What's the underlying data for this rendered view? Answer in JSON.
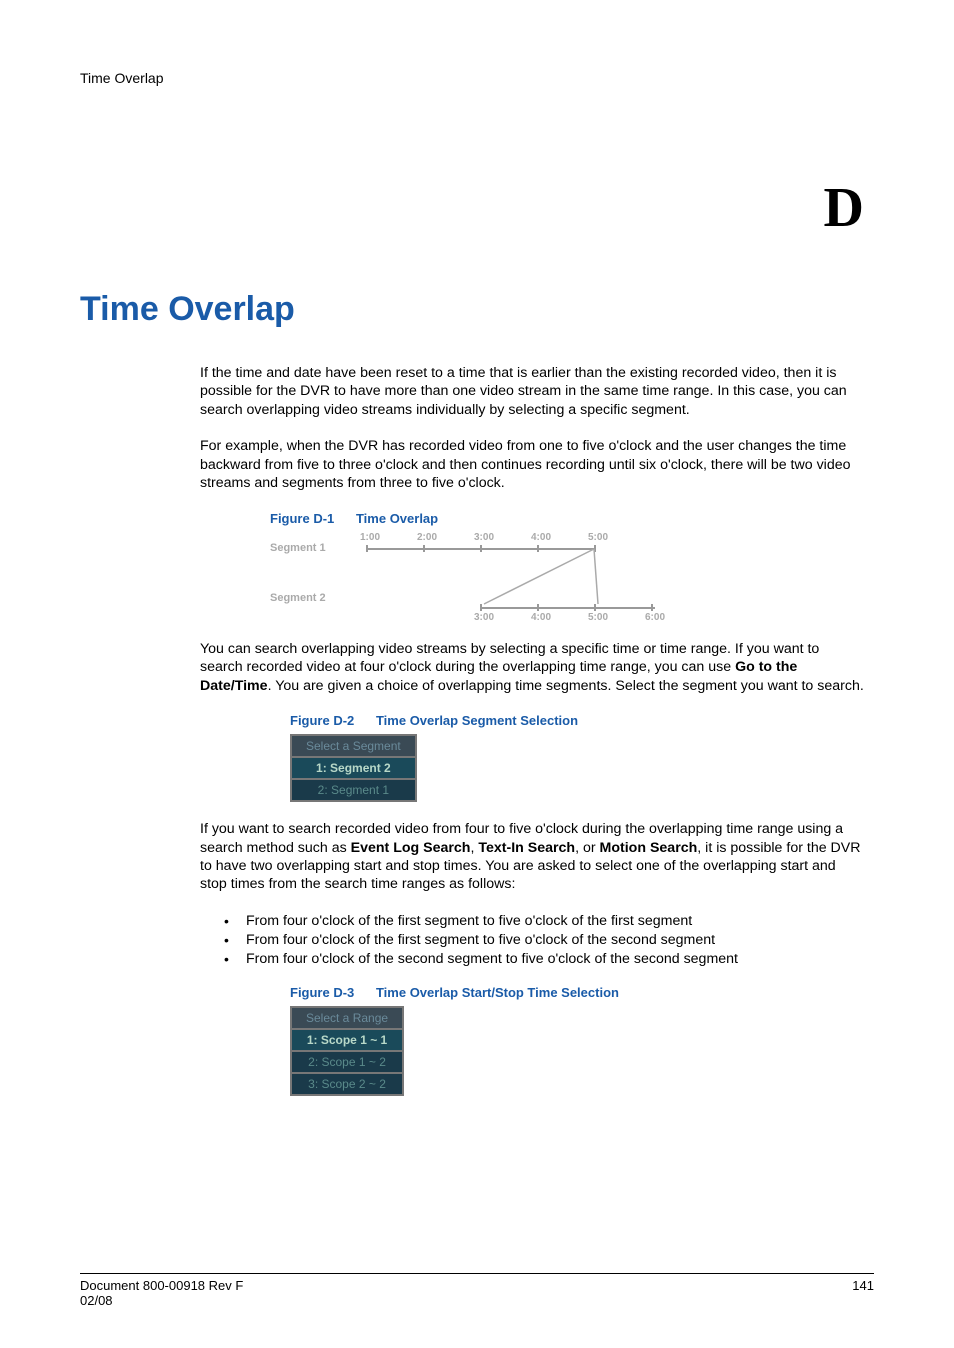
{
  "header": "Time Overlap",
  "chapter_letter": "D",
  "title": "Time Overlap",
  "para1": "If the time and date have been reset to a time that is earlier than the existing recorded video, then it is possible for the DVR to have more than one video stream in the same time range. In this case, you can search overlapping video streams individually by selecting a specific segment.",
  "para2": "For example, when the DVR has recorded video from one to five o'clock and the user changes the time backward from five to three o'clock and then continues recording until six o'clock, there will be two video streams and segments from three to five o'clock.",
  "fig1": {
    "label": "Figure D-1",
    "caption": "Time Overlap"
  },
  "diagram": {
    "seg1_label": "Segment 1",
    "seg2_label": "Segment 2",
    "top_ticks": [
      "1:00",
      "2:00",
      "3:00",
      "4:00",
      "5:00"
    ],
    "bottom_ticks": [
      "3:00",
      "4:00",
      "5:00",
      "6:00"
    ]
  },
  "para3_a": "You can search overlapping video streams by selecting a specific time or time range. If you want to search recorded video at four o'clock during the overlapping time range, you can use ",
  "para3_bold": "Go to the Date/Time",
  "para3_b": ". You are given a choice of overlapping time segments. Select the segment you want to search.",
  "fig2": {
    "label": "Figure D-2",
    "caption": "Time Overlap Segment Selection"
  },
  "seg_table1": {
    "header": "Select a Segment",
    "rows": [
      "1: Segment 2",
      "2: Segment 1"
    ]
  },
  "para4_a": "If you want to search recorded video from four to five o'clock during the overlapping time range using a search method such as ",
  "para4_b1": "Event Log Search",
  "para4_c": ", ",
  "para4_b2": "Text-In Search",
  "para4_d": ", or ",
  "para4_b3": "Motion Search",
  "para4_e": ", it is possible for the DVR to have two overlapping start and stop times. You are asked to select one of the overlapping start and stop times from the search time ranges as follows:",
  "bullets": [
    "From four o'clock of the first segment to five o'clock of the first segment",
    "From four o'clock of the first segment to five o'clock of the second segment",
    "From four o'clock of the second segment to five o'clock of the second segment"
  ],
  "fig3": {
    "label": "Figure D-3",
    "caption": "Time Overlap Start/Stop Time Selection"
  },
  "seg_table2": {
    "header": "Select a Range",
    "rows": [
      "1: Scope 1 ~ 1",
      "2: Scope 1 ~ 2",
      "3: Scope 2 ~ 2"
    ]
  },
  "footer": {
    "left1": "Document 800-00918 Rev F",
    "left2": "02/08",
    "right": "141"
  }
}
